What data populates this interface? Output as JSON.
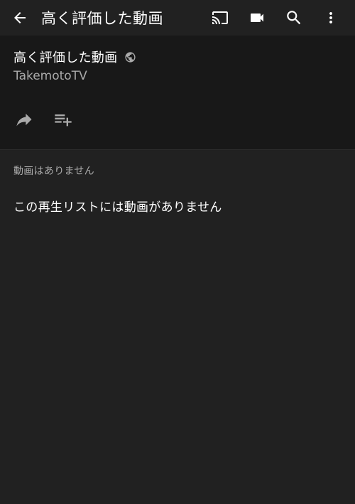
{
  "app_bar": {
    "title": "高く評価した動画",
    "icons": {
      "back": "arrow-back-icon",
      "cast": "cast-icon",
      "camera": "videocam-icon",
      "search": "search-icon",
      "more": "more-vert-icon"
    }
  },
  "playlist": {
    "title": "高く評価した動画",
    "privacy_icon": "globe-icon",
    "channel": "TakemotoTV",
    "actions": {
      "share_icon": "share-icon",
      "add_to_queue_icon": "playlist-add-icon"
    }
  },
  "content": {
    "section_label": "動画はありません",
    "empty_message": "この再生リストには動画がありません"
  },
  "colors": {
    "background": "#212121",
    "header_panel": "#181818",
    "primary_text": "#ffffff",
    "secondary_text": "#aaaaaa"
  }
}
